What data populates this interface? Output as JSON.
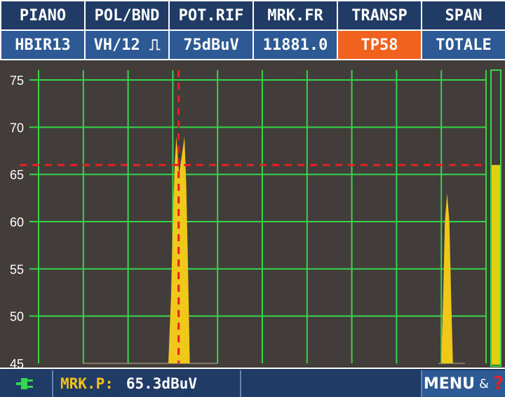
{
  "header": {
    "cells": [
      {
        "label": "PIANO",
        "value": "HBIR13"
      },
      {
        "label": "POL/BND",
        "value": "VH/12 ⎍"
      },
      {
        "label": "POT.RIF",
        "value": "75dBuV"
      },
      {
        "label": "MRK.FR",
        "value": "11881.0"
      },
      {
        "label": "TRANSP",
        "value": "TP58"
      },
      {
        "label": "SPAN",
        "value": "TOTALE"
      }
    ]
  },
  "footer": {
    "plug_icon": "power-plug-icon",
    "marker_label": "MRK.P:",
    "marker_value": "65.3dBuV",
    "menu_label": "MENU",
    "menu_amp": "&",
    "help_symbol": "?"
  },
  "colors": {
    "header_label_bg": "#1f3b66",
    "header_value_bg": "#2d5a94",
    "active_value_bg": "#f0621e",
    "plot_bg": "#423c3a",
    "grid": "#35d64a",
    "signal": "#f0c81a",
    "marker": "#e82020",
    "level_bar": "#e0d010"
  },
  "chart_data": {
    "type": "area",
    "ylim": [
      45,
      75
    ],
    "yticks": [
      75,
      70,
      65,
      60,
      55,
      50,
      45
    ],
    "marker_level": 66,
    "level_bar_value": 66,
    "peaks": [
      {
        "name": "",
        "points": [
          [
            0.29,
            45
          ],
          [
            0.296,
            52
          ],
          [
            0.3,
            60
          ],
          [
            0.304,
            66
          ],
          [
            0.308,
            69
          ],
          [
            0.314,
            65
          ],
          [
            0.32,
            67
          ],
          [
            0.326,
            69
          ],
          [
            0.33,
            64
          ],
          [
            0.334,
            55
          ],
          [
            0.338,
            45
          ]
        ]
      },
      {
        "name": "",
        "points": [
          [
            0.9,
            45
          ],
          [
            0.904,
            52
          ],
          [
            0.908,
            60
          ],
          [
            0.913,
            63
          ],
          [
            0.918,
            60
          ],
          [
            0.922,
            52
          ],
          [
            0.926,
            45
          ]
        ]
      }
    ],
    "marker_x": 0.313
  }
}
